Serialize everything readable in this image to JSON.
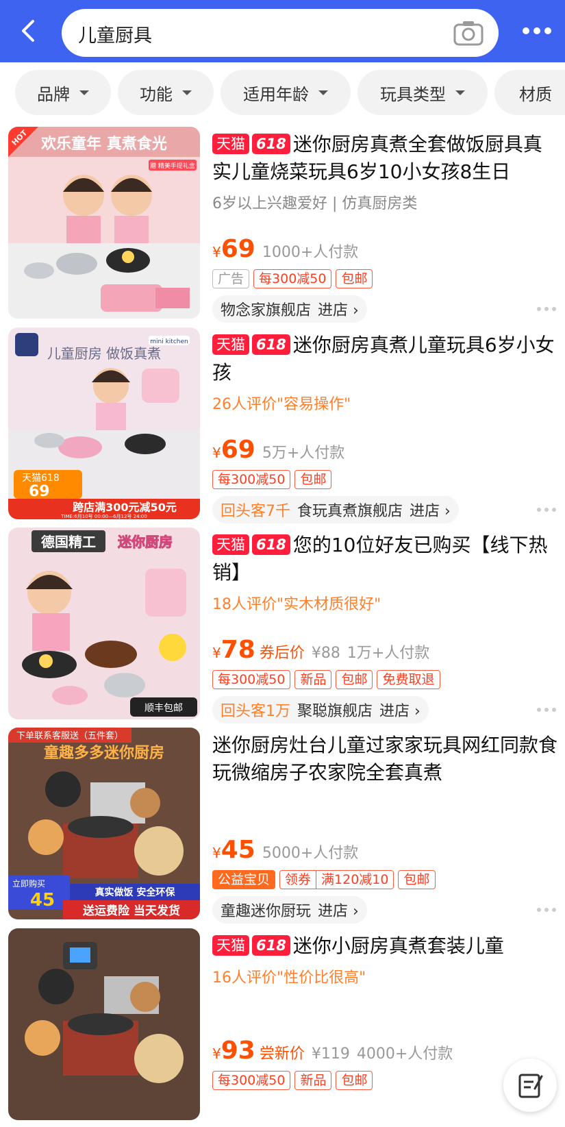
{
  "search": {
    "query": "儿童厨具"
  },
  "filters": [
    "品牌",
    "功能",
    "适用年龄",
    "玩具类型",
    "材质"
  ],
  "colors": {
    "brand_blue": "#3d63f0",
    "tmall_red": "#ff1f3d",
    "price_orange": "#ff4f00"
  },
  "products": [
    {
      "title": "迷你厨房真煮全套做饭厨具真实儿童烧菜玩具6岁10小女孩8生日",
      "tags": [
        "天猫",
        "618"
      ],
      "sub": "6岁以上兴趣爱好 | 仿真厨房类",
      "sub_style": "gray",
      "image": {
        "banner": "欢乐童年 真煮食光",
        "corner": "HOT",
        "gift": "赠 精美手提礼盒"
      },
      "yen": "¥",
      "price": "69",
      "price_label": "",
      "old_price": "",
      "sold": "1000+人付款",
      "badges": [
        {
          "text": "广告",
          "style": "gray"
        },
        {
          "text": "每300减50"
        },
        {
          "text": "包邮"
        }
      ],
      "shop_repeat": "",
      "shop": "物念家旗舰店",
      "shop_go": "进店 ›"
    },
    {
      "title": "迷你厨房真煮儿童玩具6岁小女孩",
      "tags": [
        "天猫",
        "618"
      ],
      "sub": "26人评价\"容易操作\"",
      "sub_style": "orange",
      "image": {
        "banner": "儿童厨房 做饭真煮",
        "corner": "mini kitchen",
        "promo_tag": "天猫618",
        "promo_price": "69",
        "promo_text": "跨店满300元减50元",
        "promo_time": "TIME:6月10号 00:00—6月12号 24:00"
      },
      "yen": "¥",
      "price": "69",
      "price_label": "",
      "old_price": "",
      "sold": "5万+人付款",
      "badges": [
        {
          "text": "每300减50"
        },
        {
          "text": "包邮"
        }
      ],
      "shop_repeat": "回头客7千",
      "shop": "食玩真煮旗舰店",
      "shop_go": "进店 ›"
    },
    {
      "title": "您的10位好友已购买【线下热销】",
      "tags": [
        "天猫",
        "618"
      ],
      "sub": "18人评价\"实木材质很好\"",
      "sub_style": "orange",
      "image": {
        "banner_left": "德国精工",
        "banner_right": "迷你厨房",
        "footer": "顺丰包邮"
      },
      "yen": "¥",
      "price": "78",
      "price_label": "券后价",
      "old_price": "¥88",
      "sold": "1万+人付款",
      "badges": [
        {
          "text": "每300减50"
        },
        {
          "text": "新品"
        },
        {
          "text": "包邮"
        },
        {
          "text": "免费取退"
        }
      ],
      "shop_repeat": "回头客1万",
      "shop": "聚聪旗舰店",
      "shop_go": "进店 ›"
    },
    {
      "title": "迷你厨房灶台儿童过家家玩具网红同款食玩微缩房子农家院全套真煮",
      "tags": [],
      "sub": "",
      "sub_style": "gray",
      "image": {
        "banner": "下单联系客服送（五件套）",
        "banner2": "童趣多多迷你厨房",
        "promo_tag": "立即购买",
        "promo_price": "45",
        "promo_text": "真实做饭 安全环保",
        "promo_text2": "送运费险 当天发货"
      },
      "yen": "¥",
      "price": "45",
      "price_label": "",
      "old_price": "",
      "sold": "5000+人付款",
      "badges": [
        {
          "text": "公益宝贝",
          "style": "solid"
        },
        {
          "text": "领券|满120减10",
          "style": "split"
        },
        {
          "text": "包邮"
        }
      ],
      "shop_repeat": "",
      "shop": "童趣迷你厨玩",
      "shop_go": "进店 ›"
    },
    {
      "title": "迷你小厨房真煮套装儿童",
      "tags": [
        "天猫",
        "618"
      ],
      "sub": "16人评价\"性价比很高\"",
      "sub_style": "orange",
      "image": {},
      "yen": "¥",
      "price": "93",
      "price_label": "尝新价",
      "old_price": "¥119",
      "sold": "4000+人付款",
      "badges": [
        {
          "text": "每300减50"
        },
        {
          "text": "新品"
        },
        {
          "text": "包邮"
        }
      ],
      "shop_repeat": "",
      "shop": "",
      "shop_go": ""
    }
  ]
}
